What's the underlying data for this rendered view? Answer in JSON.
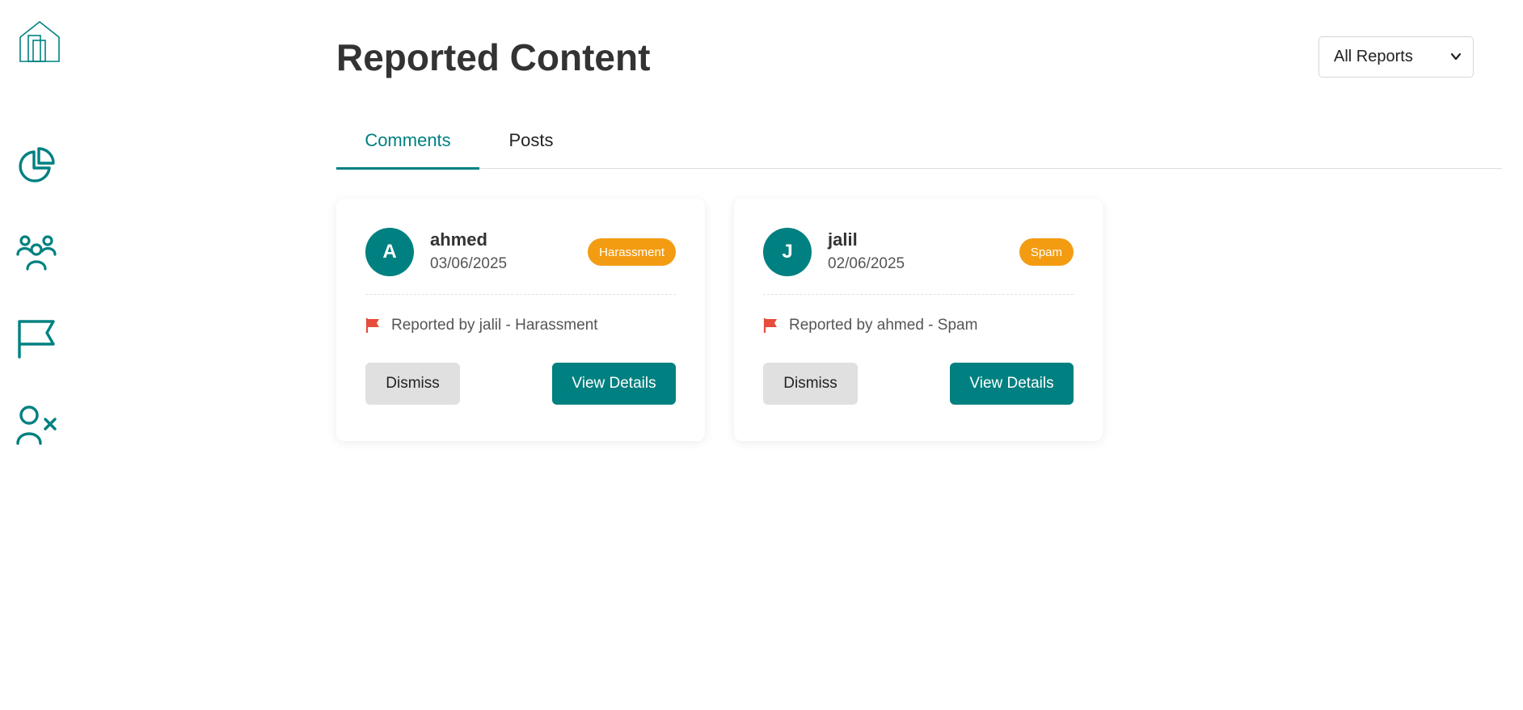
{
  "page": {
    "title": "Reported Content"
  },
  "filter": {
    "selected": "All Reports"
  },
  "tabs": [
    {
      "label": "Comments",
      "active": true
    },
    {
      "label": "Posts",
      "active": false
    }
  ],
  "sidebar": {
    "items": [
      {
        "icon": "pie-chart-icon"
      },
      {
        "icon": "users-icon"
      },
      {
        "icon": "flag-icon"
      },
      {
        "icon": "user-x-icon"
      }
    ]
  },
  "reports": [
    {
      "avatar_initial": "A",
      "username": "ahmed",
      "date": "03/06/2025",
      "badge": "Harassment",
      "report_text": "Reported by jalil - Harassment",
      "dismiss_label": "Dismiss",
      "view_label": "View Details"
    },
    {
      "avatar_initial": "J",
      "username": "jalil",
      "date": "02/06/2025",
      "badge": "Spam",
      "report_text": "Reported by ahmed - Spam",
      "dismiss_label": "Dismiss",
      "view_label": "View Details"
    }
  ],
  "colors": {
    "accent": "#008080",
    "badge": "#f39c12",
    "flag": "#e74c3c",
    "dismiss_bg": "#e0e0e0"
  }
}
